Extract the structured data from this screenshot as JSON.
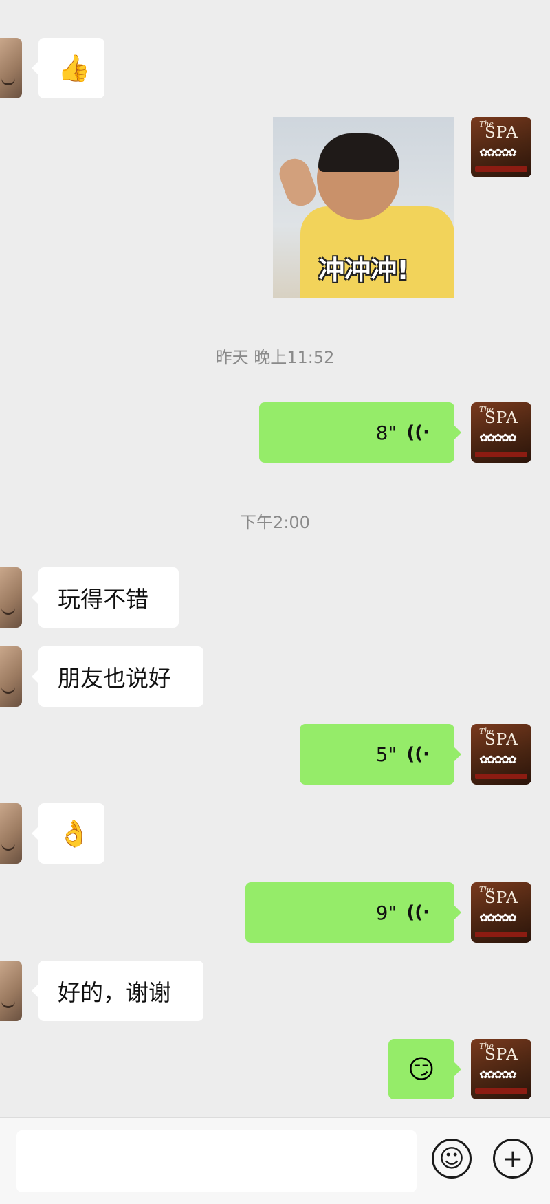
{
  "messages": {
    "m1_emoji": "👍",
    "m2_sticker_caption": "冲冲冲!",
    "time1": "昨天 晚上11:52",
    "m3_voice": "8\"",
    "time2": "下午2:00",
    "m4_text": "玩得不错",
    "m5_text": "朋友也说好",
    "m6_voice": "5\"",
    "m7_emoji": "👌",
    "m8_voice": "9\"",
    "m9_text": "好的，谢谢",
    "m10_emoji": "😏"
  },
  "avatars": {
    "right_label_small": "The",
    "right_label_big": "SPA"
  },
  "icons": {
    "voice": "voice-wave-icon",
    "emoji_button": "smiley-icon",
    "plus_button": "plus-icon"
  },
  "colors": {
    "background": "#ededed",
    "sent_bubble": "#95ec69",
    "received_bubble": "#ffffff"
  }
}
